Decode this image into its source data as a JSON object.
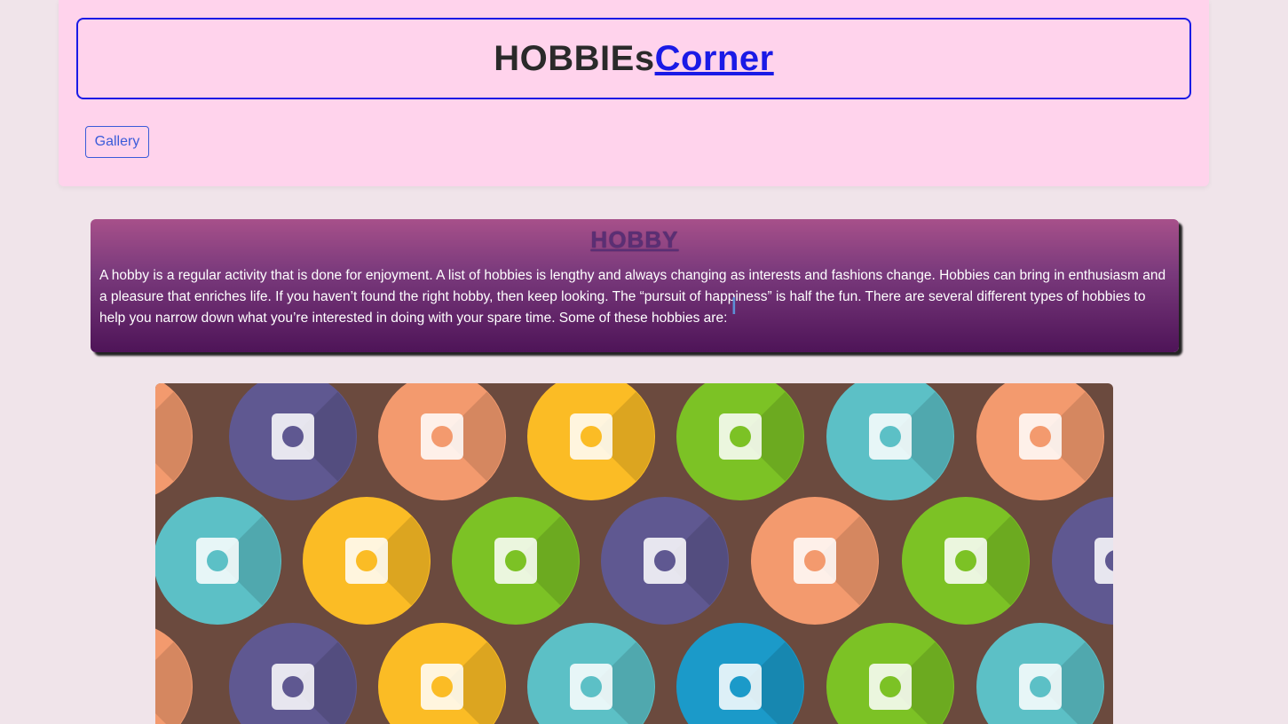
{
  "header": {
    "title_main": "HOBBIEs",
    "title_link": "Corner",
    "gallery_label": "Gallery"
  },
  "hobby_card": {
    "title": "HOBBY",
    "text": "A hobby is a regular activity that is done for enjoyment. A list of hobbies is lengthy and always changing as interests and fashions change. Hobbies can bring in enthusiasm and a pleasure that enriches life. If you haven’t found the right hobby, then keep looking. The “pursuit of happiness” is half the fun. There are several different types of hobbies to help you narrow down what you’re interested in doing with your spare time. Some of these hobbies are:"
  },
  "colors": {
    "page_bg": "#f0e4ea",
    "panel_bg": "#ffd3ec",
    "accent": "#1a1ae6",
    "card_top": "#a7508a",
    "card_bottom": "#4e1458",
    "image_bg": "#6b4a3e"
  },
  "gallery_icons": [
    {
      "name": "aquarium-icon",
      "color": "#f39a6e"
    },
    {
      "name": "gamepad-icon",
      "color": "#5f5891"
    },
    {
      "name": "camera-icon",
      "color": "#f39a6e"
    },
    {
      "name": "tablet-icon",
      "color": "#fbbc25"
    },
    {
      "name": "cake-icon",
      "color": "#7cc225"
    },
    {
      "name": "palette-icon",
      "color": "#5cc0c6"
    },
    {
      "name": "origami-bird-icon",
      "color": "#f39a6e"
    },
    {
      "name": "puzzle-icon",
      "color": "#5cc0c6"
    },
    {
      "name": "gardening-icon",
      "color": "#fbbc25"
    },
    {
      "name": "knitting-icon",
      "color": "#7cc225"
    },
    {
      "name": "playing-cards-icon",
      "color": "#5f5891"
    },
    {
      "name": "turntable-icon",
      "color": "#f39a6e"
    },
    {
      "name": "chef-hat-icon",
      "color": "#7cc225"
    },
    {
      "name": "tent-icon",
      "color": "#5f5891"
    },
    {
      "name": "glasses-icon",
      "color": "#f39a6e"
    },
    {
      "name": "stamp-icon",
      "color": "#5f5891"
    },
    {
      "name": "microphone-icon",
      "color": "#fbbc25"
    },
    {
      "name": "bicycle-icon",
      "color": "#5cc0c6"
    },
    {
      "name": "fishing-icon",
      "color": "#1b9ac9"
    },
    {
      "name": "guitar-icon",
      "color": "#7cc225"
    },
    {
      "name": "airplane-icon",
      "color": "#5cc0c6"
    }
  ]
}
